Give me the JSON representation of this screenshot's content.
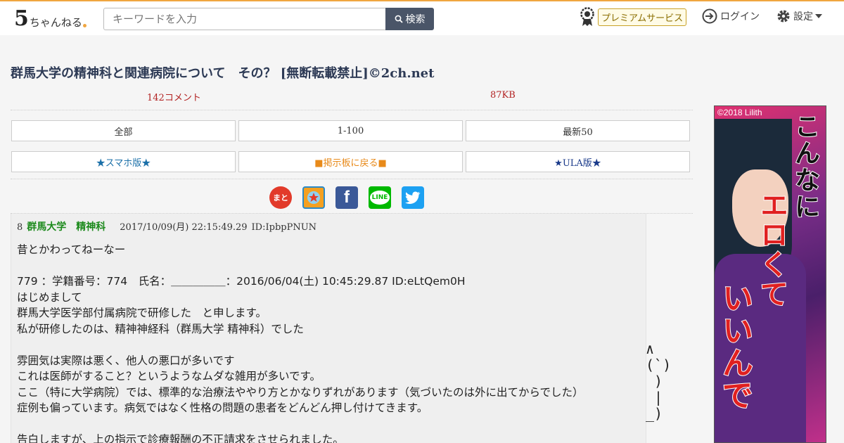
{
  "header": {
    "logo_five": "5",
    "logo_text": "ちゃんねる",
    "search_placeholder": "キーワードを入力",
    "search_button": "検索",
    "premium_label": "プレミアムサービス",
    "login_label": "ログイン",
    "settings_label": "設定"
  },
  "thread": {
    "title": "群馬大学の精神科と関連病院について　その？ [無断転載禁止]©2ch.net",
    "comment_count": "142コメント",
    "size": "87KB"
  },
  "nav": {
    "row1": [
      "全部",
      "1-100",
      "最新50"
    ],
    "row2": [
      "★スマホ版★",
      "■掲示板に戻る■",
      "★ULA版★"
    ]
  },
  "share": {
    "icons": [
      "matome-icon",
      "bookmark-icon",
      "facebook-icon",
      "line-icon",
      "twitter-icon"
    ],
    "matome_glyph": "まと",
    "facebook_glyph": "f",
    "line_glyph": "LINE"
  },
  "post": {
    "number": "8",
    "name": "群馬大学　精神科",
    "date": "2017/10/09(月) 22:15:49.29",
    "id": "ID:IpbpPNUN",
    "body": "昔とかわってねーなー\n\n779 ：学籍番号：774　氏名：＿＿＿＿＿：2016/06/04(土) 10:45:29.87 ID:eLtQem0H\nはじめまして\n群馬大学医学部付属病院で研修した　と申します。\n私が研修したのは、精神神経科（群馬大学 精神科）でした\n\n雰囲気は実際は悪く、他人の悪口が多いです\nこれは医師がすること？というようなムダな雑用が多いです。\nここ（特に大学病院）では、標準的な治療法ややり方とかなりずれがあります（気づいたのは外に出てからでした）\n症例も偏っています。病気ではなく性格の問題の患者をどんどん押し付けてきます。\n\n告白しますが、上の指示で診療報酬の不正請求をさせられました。"
  },
  "ascii_art": "∧\n(`)\n )\n |\n_)",
  "ad": {
    "copyright": "©2018 Lilith",
    "line1": "こんなに",
    "line2": "エロくて",
    "line3": "いいんで"
  },
  "colors": {
    "accent_orange": "#f0a640",
    "title_navy": "#2d3a55",
    "meta_red": "#b22222",
    "name_green": "#1c8a1c",
    "sumaho_blue": "#1a6fa8",
    "back_orange": "#e88a1a",
    "ula_navy": "#1a3a8a"
  }
}
